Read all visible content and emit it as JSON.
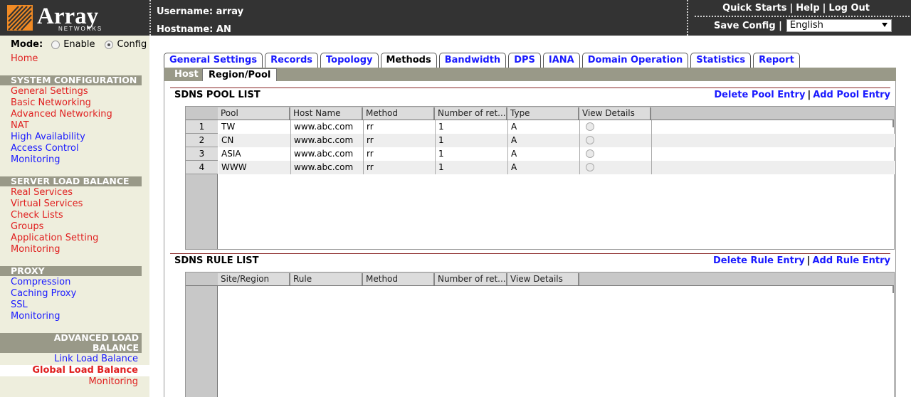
{
  "header": {
    "brand": "Array",
    "brand_sub": "NETWORKS",
    "username_label": "Username:",
    "username": "array",
    "hostname_label": "Hostname:",
    "hostname": "AN",
    "links": [
      "Quick Starts",
      "Help",
      "Log Out"
    ],
    "save_config": "Save Config",
    "language": "English",
    "colors": {
      "bg": "#333333",
      "logo_orange": "#f08a24"
    }
  },
  "sidebar": {
    "mode_label": "Mode:",
    "mode_options": [
      "Enable",
      "Config"
    ],
    "mode_selected": "Config",
    "home": "Home",
    "system_configuration": {
      "title": "SYSTEM CONFIGURATION",
      "items": [
        "General Settings",
        "Basic Networking",
        "Advanced Networking",
        "NAT",
        "High Availability",
        "Access Control",
        "Monitoring"
      ]
    },
    "server_load_balance": {
      "title": "SERVER LOAD BALANCE",
      "items": [
        "Real Services",
        "Virtual Services",
        "Check Lists",
        "Groups",
        "Application Setting",
        "Monitoring"
      ]
    },
    "proxy": {
      "title": "PROXY",
      "items": [
        "Compression",
        "Caching Proxy",
        "SSL",
        "Monitoring"
      ]
    },
    "advanced_load_balance": {
      "title_line1": "ADVANCED LOAD",
      "title_line2": "BALANCE",
      "items": [
        "Link Load Balance",
        "Global Load Balance",
        "Monitoring"
      ],
      "selected": "Global Load Balance"
    }
  },
  "tabs": [
    "General Settings",
    "Records",
    "Topology",
    "Methods",
    "Bandwidth",
    "DPS",
    "IANA",
    "Domain Operation",
    "Statistics",
    "Report"
  ],
  "active_tab": "Methods",
  "subtabs": [
    "Host",
    "Region/Pool"
  ],
  "active_subtab": "Region/Pool",
  "pool_list": {
    "title": "SDNS POOL LIST",
    "delete_action": "Delete Pool Entry",
    "add_action": "Add Pool Entry",
    "columns": [
      "Pool",
      "Host Name",
      "Method",
      "Number of ret...",
      "Type",
      "View Details"
    ],
    "rows": [
      {
        "num": "1",
        "pool": "TW",
        "host": "www.abc.com",
        "method": "rr",
        "number": "1",
        "type": "A"
      },
      {
        "num": "2",
        "pool": "CN",
        "host": "www.abc.com",
        "method": "rr",
        "number": "1",
        "type": "A"
      },
      {
        "num": "3",
        "pool": "ASIA",
        "host": "www.abc.com",
        "method": "rr",
        "number": "1",
        "type": "A"
      },
      {
        "num": "4",
        "pool": "WWW",
        "host": "www.abc.com",
        "method": "rr",
        "number": "1",
        "type": "A"
      }
    ]
  },
  "rule_list": {
    "title": "SDNS RULE LIST",
    "delete_action": "Delete Rule Entry",
    "add_action": "Add Rule Entry",
    "columns": [
      "Site/Region",
      "Rule",
      "Method",
      "Number of ret...",
      "View Details"
    ]
  }
}
